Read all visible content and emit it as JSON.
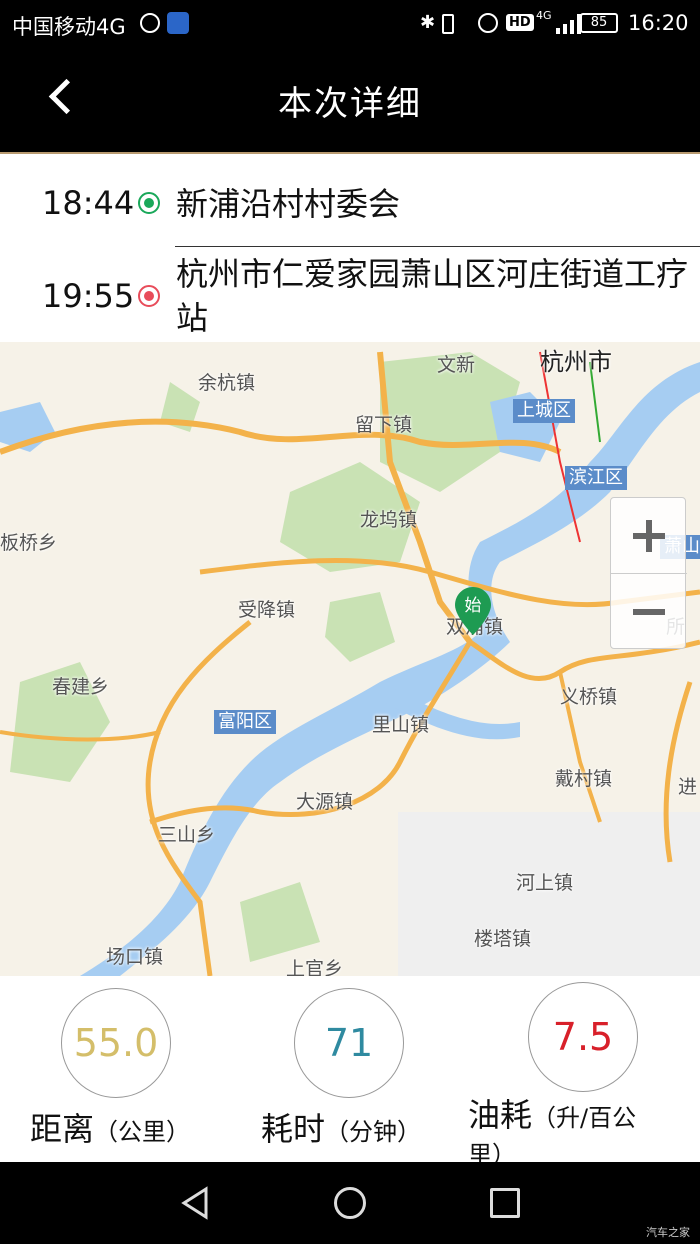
{
  "status_bar": {
    "carrier": "中国移动4G",
    "network": "4G",
    "battery": "85",
    "time": "16:20"
  },
  "header": {
    "title": "本次详细"
  },
  "trip": {
    "start": {
      "time": "18:44",
      "name": "新浦沿村村委会"
    },
    "end": {
      "time": "19:55",
      "name": "杭州市仁爱家园萧山区河庄街道工疗站"
    }
  },
  "map": {
    "labels": {
      "hangzhou": "杭州市",
      "wenxin": "文新",
      "yuhang": "余杭镇",
      "liuxia": "留下镇",
      "shangcheng": "上城区",
      "binjiang": "滨江区",
      "xiaoshan": "萧山区",
      "longwu": "龙坞镇",
      "banqiao": "板桥乡",
      "shoujiang": "受降镇",
      "shuangpu": "双浦镇",
      "chunjian": "春建乡",
      "fuyang": "富阳区",
      "lishan": "里山镇",
      "yiqiao": "义桥镇",
      "daicun": "戴村镇",
      "dayuan": "大源镇",
      "sanshan": "三山乡",
      "heshang": "河上镇",
      "louta": "楼塔镇",
      "changkou": "场口镇",
      "shangguan": "上官乡",
      "jin": "进",
      "suo": "所"
    },
    "pin_label": "始",
    "zoom_in": "+",
    "zoom_out": "−"
  },
  "stats": {
    "distance": {
      "value": "55.0",
      "label": "距离",
      "unit": "（公里）",
      "color": "#d4be6a"
    },
    "duration": {
      "value": "71",
      "label": "耗时",
      "unit": "（分钟）",
      "color": "#2f8aa0"
    },
    "fuel": {
      "value": "7.5",
      "label": "油耗",
      "unit": "（升/百公里）",
      "color": "#d8202a"
    }
  },
  "watermark": "汽车之家"
}
